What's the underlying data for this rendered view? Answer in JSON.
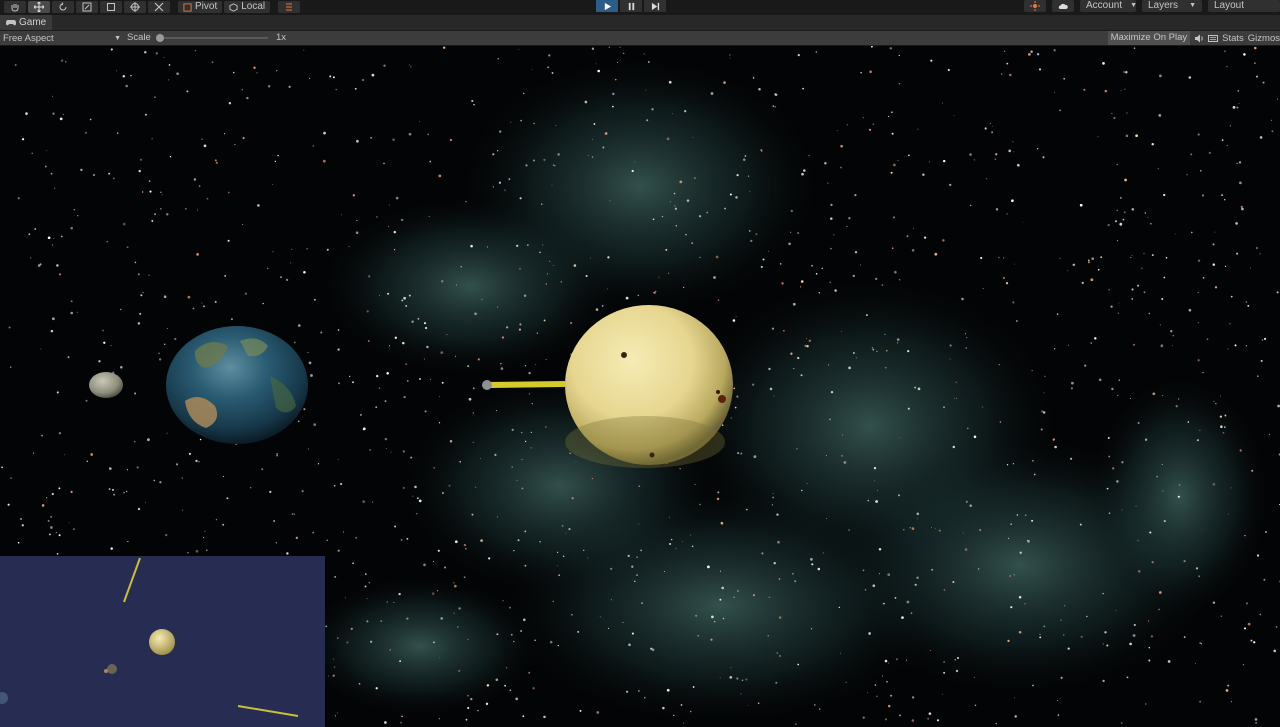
{
  "toolbar": {
    "tools": [
      "hand-tool",
      "move-tool",
      "rotate-tool",
      "scale-tool",
      "rect-tool",
      "transform-tool",
      "custom-tool"
    ],
    "pivot_label": "Pivot",
    "local_label": "Local",
    "play_controls": [
      "play",
      "pause",
      "step"
    ],
    "account_label": "Account",
    "layers_label": "Layers",
    "layout_label": "Layout"
  },
  "tab": {
    "title": "Game"
  },
  "gameview": {
    "aspect": "Free Aspect",
    "scale_label": "Scale",
    "scale_value": "1x",
    "maximize_label": "Maximize On Play",
    "stats_label": "Stats",
    "gizmos_label": "Gizmos"
  },
  "colors": {
    "play_active": "#2c5d87",
    "sun": "#e9dc98",
    "earth_ocean": "#1d4f66",
    "minimap_bg": "#272d52"
  }
}
